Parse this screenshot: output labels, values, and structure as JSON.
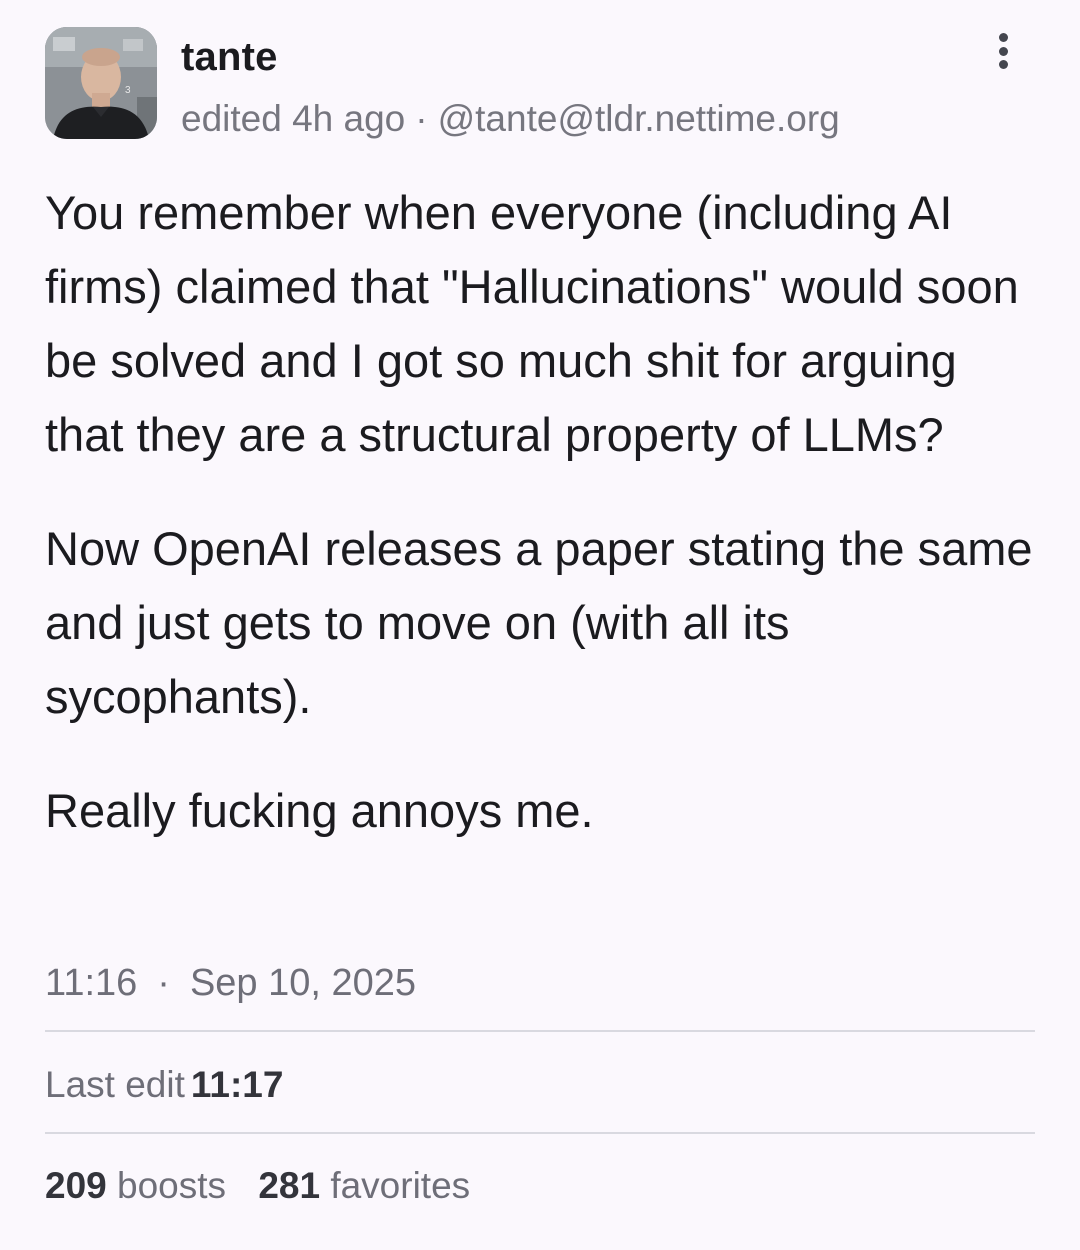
{
  "author": {
    "display_name": "tante",
    "edited_label": "edited 4h ago",
    "separator": "·",
    "handle": "@tante@tldr.nettime.org",
    "avatar_icon": "profile-photo"
  },
  "menu": {
    "icon": "more-vertical-icon"
  },
  "post": {
    "paragraphs": [
      "You remember when everyone (including AI firms) claimed that \"Hallucinations\" would soon be solved and I got so much shit for arguing that they are a structural property of LLMs?",
      "Now OpenAI releases a paper stating the same and just gets to move on (with all its sycophants).",
      "Really fucking annoys me."
    ]
  },
  "timestamp": {
    "time": "11:16",
    "separator": "·",
    "date": "Sep 10, 2025"
  },
  "last_edit": {
    "label": "Last edit",
    "time": "11:17"
  },
  "stats": {
    "boosts_count": "209",
    "boosts_label": "boosts",
    "favorites_count": "281",
    "favorites_label": "favorites"
  },
  "colors": {
    "background": "#fbf8fd",
    "text_primary": "#1b1b1f",
    "text_secondary": "#76767f",
    "divider": "#d9d9e0"
  }
}
